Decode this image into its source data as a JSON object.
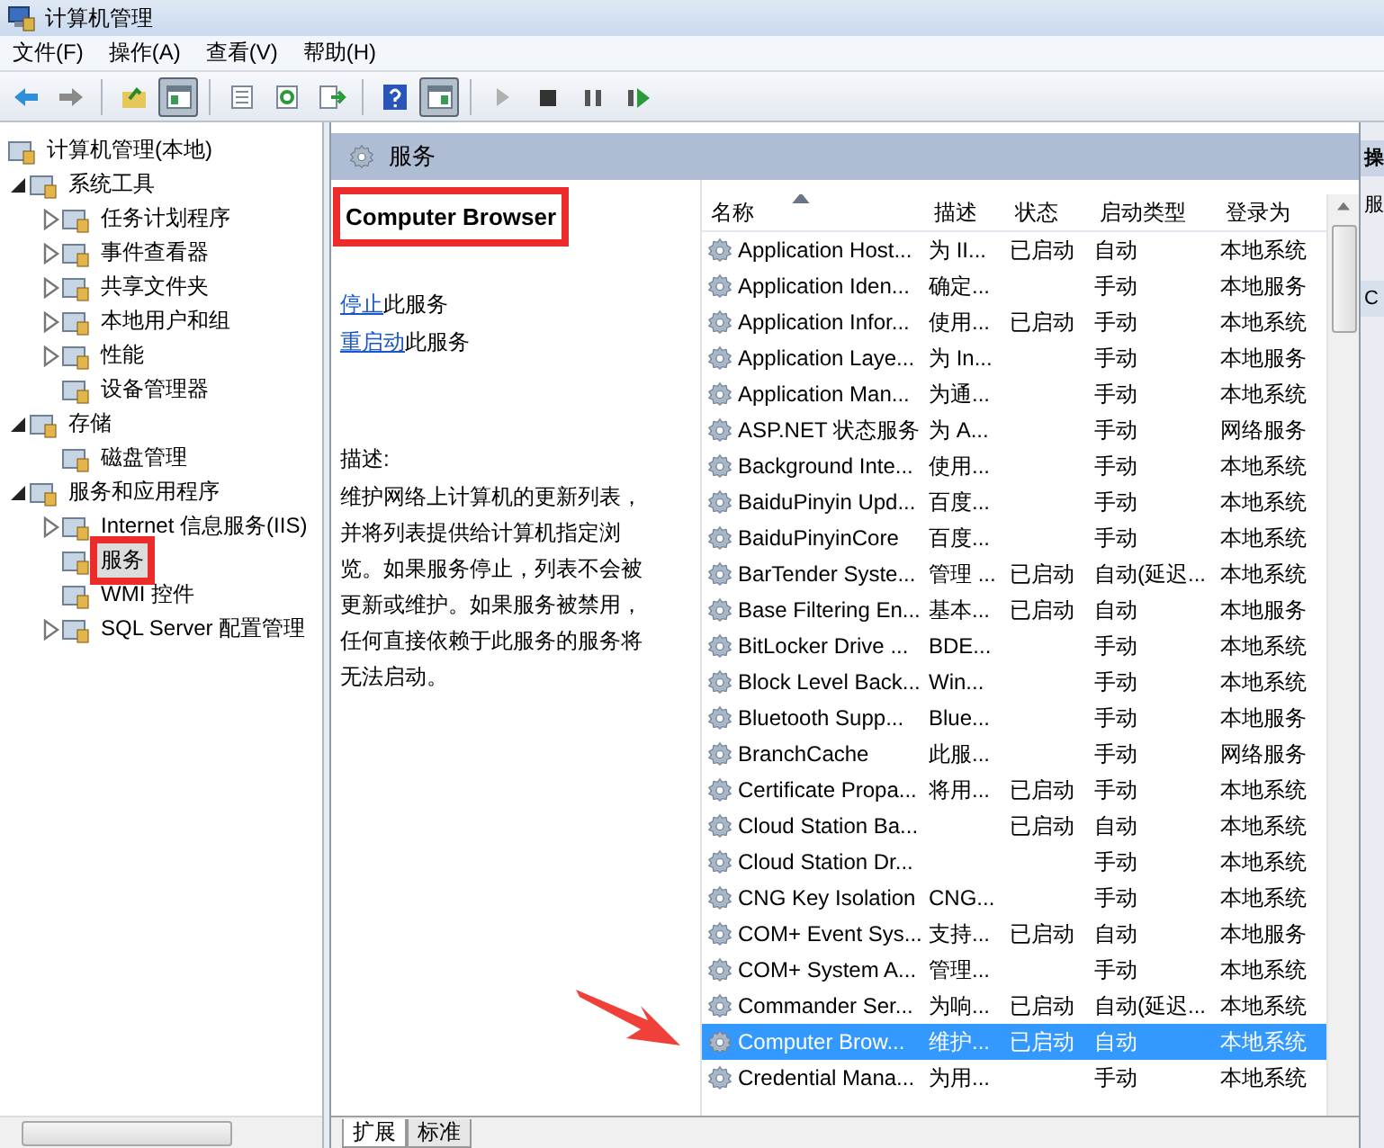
{
  "window": {
    "title": "计算机管理"
  },
  "menu": [
    "文件(F)",
    "操作(A)",
    "查看(V)",
    "帮助(H)"
  ],
  "toolbar": [
    {
      "buttons": [
        {
          "kind": "back",
          "pressed": false
        },
        {
          "kind": "forward",
          "pressed": false
        }
      ]
    },
    {
      "buttons": [
        {
          "kind": "up",
          "pressed": false
        },
        {
          "kind": "tree",
          "pressed": true
        }
      ]
    },
    {
      "buttons": [
        {
          "kind": "properties",
          "pressed": false
        },
        {
          "kind": "refresh",
          "pressed": false
        },
        {
          "kind": "export",
          "pressed": false
        }
      ]
    },
    {
      "buttons": [
        {
          "kind": "help",
          "pressed": false
        },
        {
          "kind": "pane",
          "pressed": true
        }
      ]
    },
    {
      "buttons": [
        {
          "kind": "play",
          "pressed": false
        },
        {
          "kind": "stop",
          "pressed": false
        },
        {
          "kind": "pause",
          "pressed": false
        },
        {
          "kind": "resume",
          "pressed": false
        }
      ]
    }
  ],
  "tree": [
    {
      "label": "计算机管理(本地)",
      "selected": false,
      "highlighted": false,
      "children": [
        {
          "label": "系统工具",
          "expanded": true,
          "selected": false,
          "highlighted": false,
          "children": [
            {
              "label": "任务计划程序",
              "expanded": false,
              "selected": false,
              "highlighted": false
            },
            {
              "label": "事件查看器",
              "expanded": false,
              "selected": false,
              "highlighted": false
            },
            {
              "label": "共享文件夹",
              "expanded": false,
              "selected": false,
              "highlighted": false
            },
            {
              "label": "本地用户和组",
              "expanded": false,
              "selected": false,
              "highlighted": false
            },
            {
              "label": "性能",
              "expanded": false,
              "selected": false,
              "highlighted": false
            },
            {
              "label": "设备管理器",
              "selected": false,
              "highlighted": false
            }
          ]
        },
        {
          "label": "存储",
          "expanded": true,
          "selected": false,
          "highlighted": false,
          "children": [
            {
              "label": "磁盘管理",
              "selected": false,
              "highlighted": false
            }
          ]
        },
        {
          "label": "服务和应用程序",
          "expanded": true,
          "selected": false,
          "highlighted": false,
          "children": [
            {
              "label": "Internet 信息服务(IIS)",
              "expanded": false,
              "selected": false,
              "highlighted": false
            },
            {
              "label": "服务",
              "selected": true,
              "highlighted": true
            },
            {
              "label": "WMI 控件",
              "selected": false,
              "highlighted": false
            },
            {
              "label": "SQL Server 配置管理",
              "expanded": false,
              "selected": false,
              "highlighted": false
            }
          ]
        }
      ]
    }
  ],
  "pane_header": "服务",
  "detail": {
    "title": "Computer Browser",
    "highlighted": true,
    "actions": [
      {
        "link": "停止",
        "text": "此服务"
      },
      {
        "link": "重启动",
        "text": "此服务"
      }
    ],
    "description_label": "描述:",
    "description": "维护网络上计算机的更新列表，并将列表提供给计算机指定浏览。如果服务停止，列表不会被更新或维护。如果服务被禁用，任何直接依赖于此服务的服务将无法启动。"
  },
  "table": {
    "columns": [
      {
        "label": "名称",
        "sorted": true
      },
      {
        "label": "描述",
        "sorted": false
      },
      {
        "label": "状态",
        "sorted": false
      },
      {
        "label": "启动类型",
        "sorted": false
      },
      {
        "label": "登录为",
        "sorted": false
      }
    ],
    "rows": [
      {
        "cells": [
          "Application Host...",
          "为 II...",
          "已启动",
          "自动",
          "本地系统"
        ],
        "selected": false
      },
      {
        "cells": [
          "Application Iden...",
          "确定...",
          "",
          "手动",
          "本地服务"
        ],
        "selected": false
      },
      {
        "cells": [
          "Application Infor...",
          "使用...",
          "已启动",
          "手动",
          "本地系统"
        ],
        "selected": false
      },
      {
        "cells": [
          "Application Laye...",
          "为 In...",
          "",
          "手动",
          "本地服务"
        ],
        "selected": false
      },
      {
        "cells": [
          "Application Man...",
          "为通...",
          "",
          "手动",
          "本地系统"
        ],
        "selected": false
      },
      {
        "cells": [
          "ASP.NET 状态服务",
          "为 A...",
          "",
          "手动",
          "网络服务"
        ],
        "selected": false
      },
      {
        "cells": [
          "Background Inte...",
          "使用...",
          "",
          "手动",
          "本地系统"
        ],
        "selected": false
      },
      {
        "cells": [
          "BaiduPinyin Upd...",
          "百度...",
          "",
          "手动",
          "本地系统"
        ],
        "selected": false
      },
      {
        "cells": [
          "BaiduPinyinCore",
          "百度...",
          "",
          "手动",
          "本地系统"
        ],
        "selected": false
      },
      {
        "cells": [
          "BarTender Syste...",
          "管理 ...",
          "已启动",
          "自动(延迟...",
          "本地系统"
        ],
        "selected": false
      },
      {
        "cells": [
          "Base Filtering En...",
          "基本...",
          "已启动",
          "自动",
          "本地服务"
        ],
        "selected": false
      },
      {
        "cells": [
          "BitLocker Drive ...",
          "BDE...",
          "",
          "手动",
          "本地系统"
        ],
        "selected": false
      },
      {
        "cells": [
          "Block Level Back...",
          "Win...",
          "",
          "手动",
          "本地系统"
        ],
        "selected": false
      },
      {
        "cells": [
          "Bluetooth Supp...",
          "Blue...",
          "",
          "手动",
          "本地服务"
        ],
        "selected": false
      },
      {
        "cells": [
          "BranchCache",
          "此服...",
          "",
          "手动",
          "网络服务"
        ],
        "selected": false
      },
      {
        "cells": [
          "Certificate Propa...",
          "将用...",
          "已启动",
          "手动",
          "本地系统"
        ],
        "selected": false
      },
      {
        "cells": [
          "Cloud Station Ba...",
          "",
          "已启动",
          "自动",
          "本地系统"
        ],
        "selected": false
      },
      {
        "cells": [
          "Cloud Station Dr...",
          "",
          "",
          "手动",
          "本地系统"
        ],
        "selected": false
      },
      {
        "cells": [
          "CNG Key Isolation",
          "CNG...",
          "",
          "手动",
          "本地系统"
        ],
        "selected": false
      },
      {
        "cells": [
          "COM+ Event Sys...",
          "支持...",
          "已启动",
          "自动",
          "本地服务"
        ],
        "selected": false
      },
      {
        "cells": [
          "COM+ System A...",
          "管理...",
          "",
          "手动",
          "本地系统"
        ],
        "selected": false
      },
      {
        "cells": [
          "Commander Ser...",
          "为响...",
          "已启动",
          "自动(延迟...",
          "本地系统"
        ],
        "selected": false
      },
      {
        "cells": [
          "Computer Brow...",
          "维护...",
          "已启动",
          "自动",
          "本地系统"
        ],
        "selected": true
      },
      {
        "cells": [
          "Credential Mana...",
          "为用...",
          "",
          "手动",
          "本地系统"
        ],
        "selected": false
      }
    ]
  },
  "action_pane": [
    "操",
    "服",
    "C"
  ],
  "bottom_tabs": [
    {
      "label": "扩展",
      "selected": true
    },
    {
      "label": "标准",
      "selected": false
    }
  ],
  "callout_arrow": true
}
